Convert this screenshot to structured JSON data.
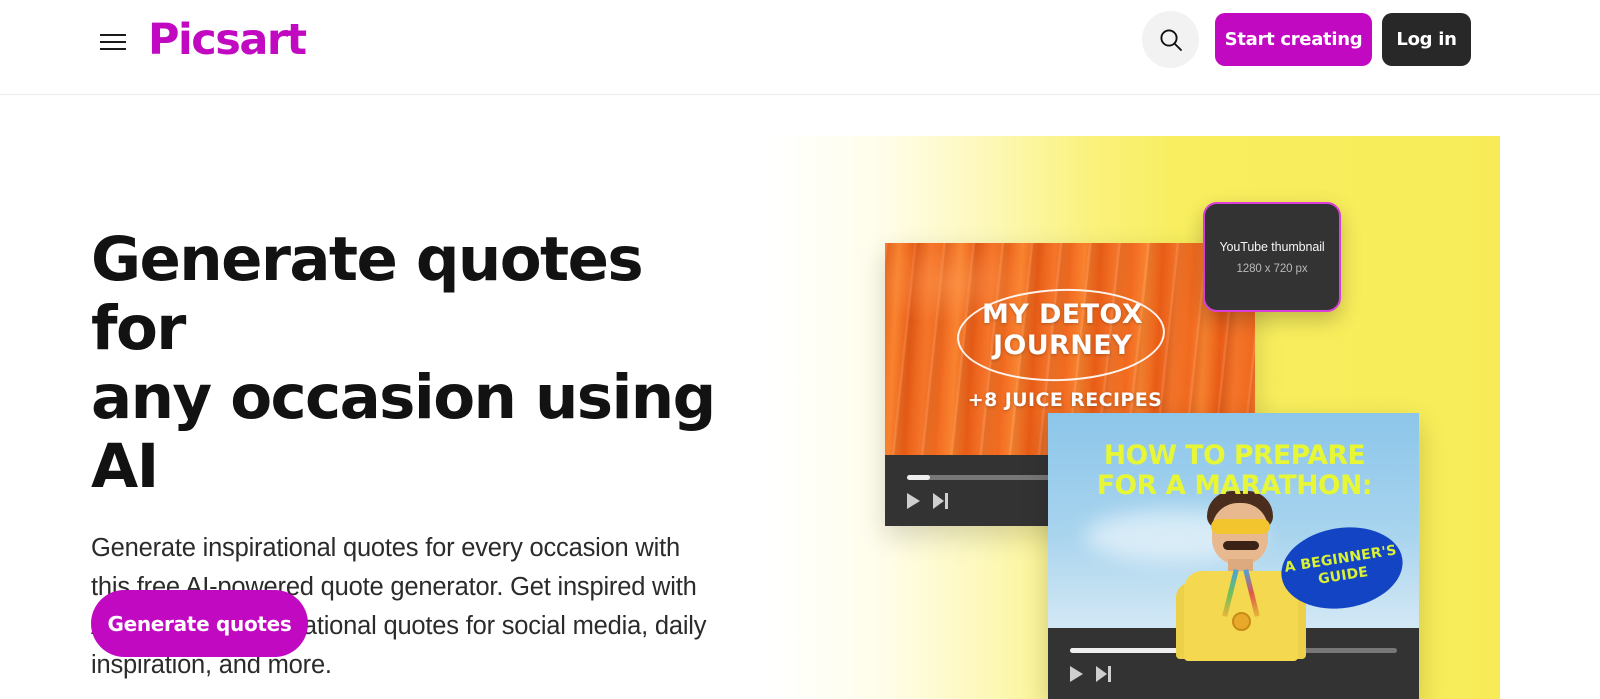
{
  "header": {
    "menu_icon": "hamburger-icon",
    "logo_text": "Picsart",
    "search_icon": "search-icon",
    "start_creating_label": "Start creating",
    "login_label": "Log in",
    "brand_color": "#c209c2",
    "login_bg_color": "#282828"
  },
  "hero": {
    "headline": "Generate quotes for\nany occasion using AI",
    "subhead": "Generate inspirational quotes for every occasion with this free AI-powered quote generator. Get inspired with AI-generated motivational quotes for social media, daily inspiration, and more.",
    "cta_label": "Generate quotes",
    "cta_color": "#c209c2"
  },
  "visual": {
    "background_color": "#f7ec58",
    "carrot_card": {
      "title": "MY DETOX\nJOURNEY",
      "subtitle": "+8 JUICE RECIPES",
      "player": {
        "progress_percent": 4,
        "play_icon": "play-icon",
        "next_icon": "next-track-icon"
      }
    },
    "tooltip_card": {
      "title": "YouTube thumbnail",
      "subtitle": "1280 x 720 px",
      "border_color": "#d93fd9",
      "background_color": "#333333"
    },
    "marathon_card": {
      "title": "HOW TO PREPARE\nFOR A MARATHON:",
      "badge_text": "A BEGINNER'S\nGUIDE",
      "title_color": "#e8f735",
      "badge_color": "#1344c4",
      "player": {
        "progress_percent": 50,
        "play_icon": "play-icon",
        "next_icon": "next-track-icon"
      }
    }
  }
}
